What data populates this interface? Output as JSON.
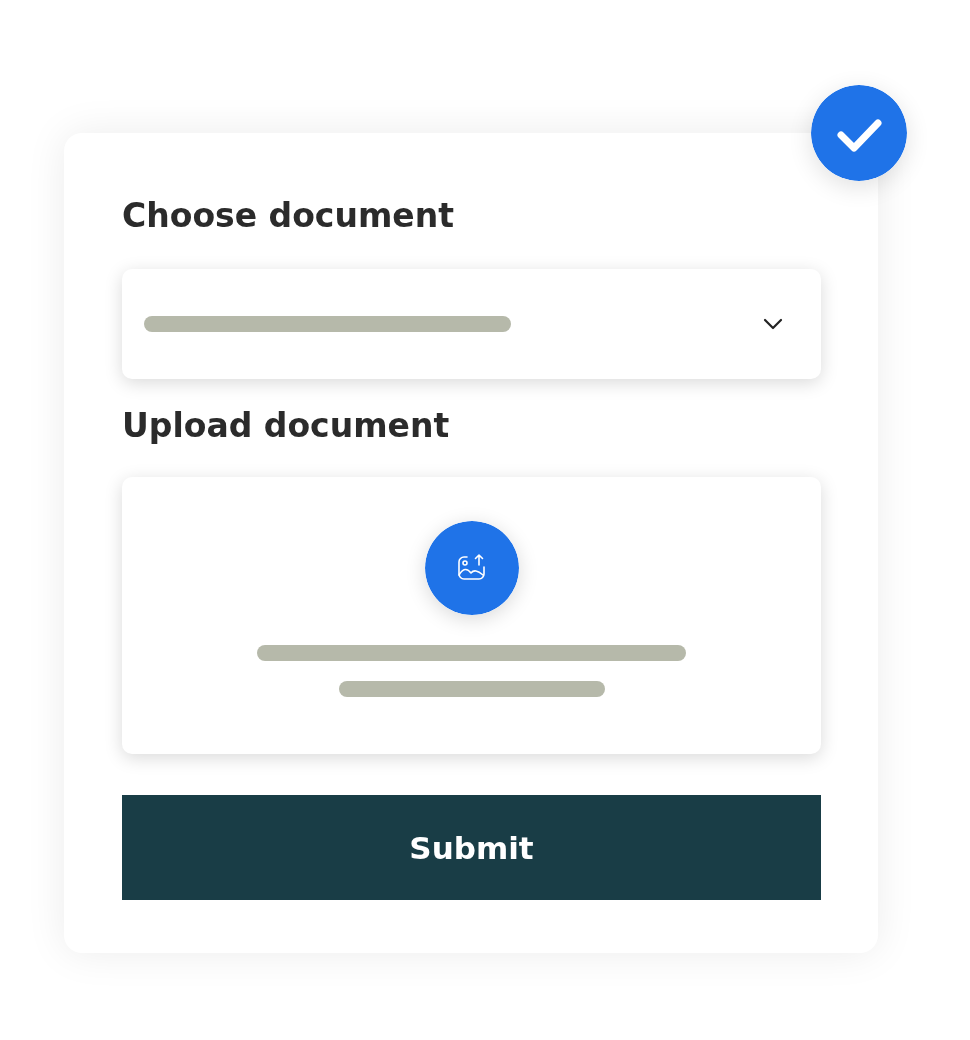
{
  "form": {
    "sections": [
      {
        "kind": "select",
        "title": "Choose document"
      },
      {
        "kind": "upload",
        "title": "Upload document"
      }
    ],
    "submit": "Submit"
  }
}
